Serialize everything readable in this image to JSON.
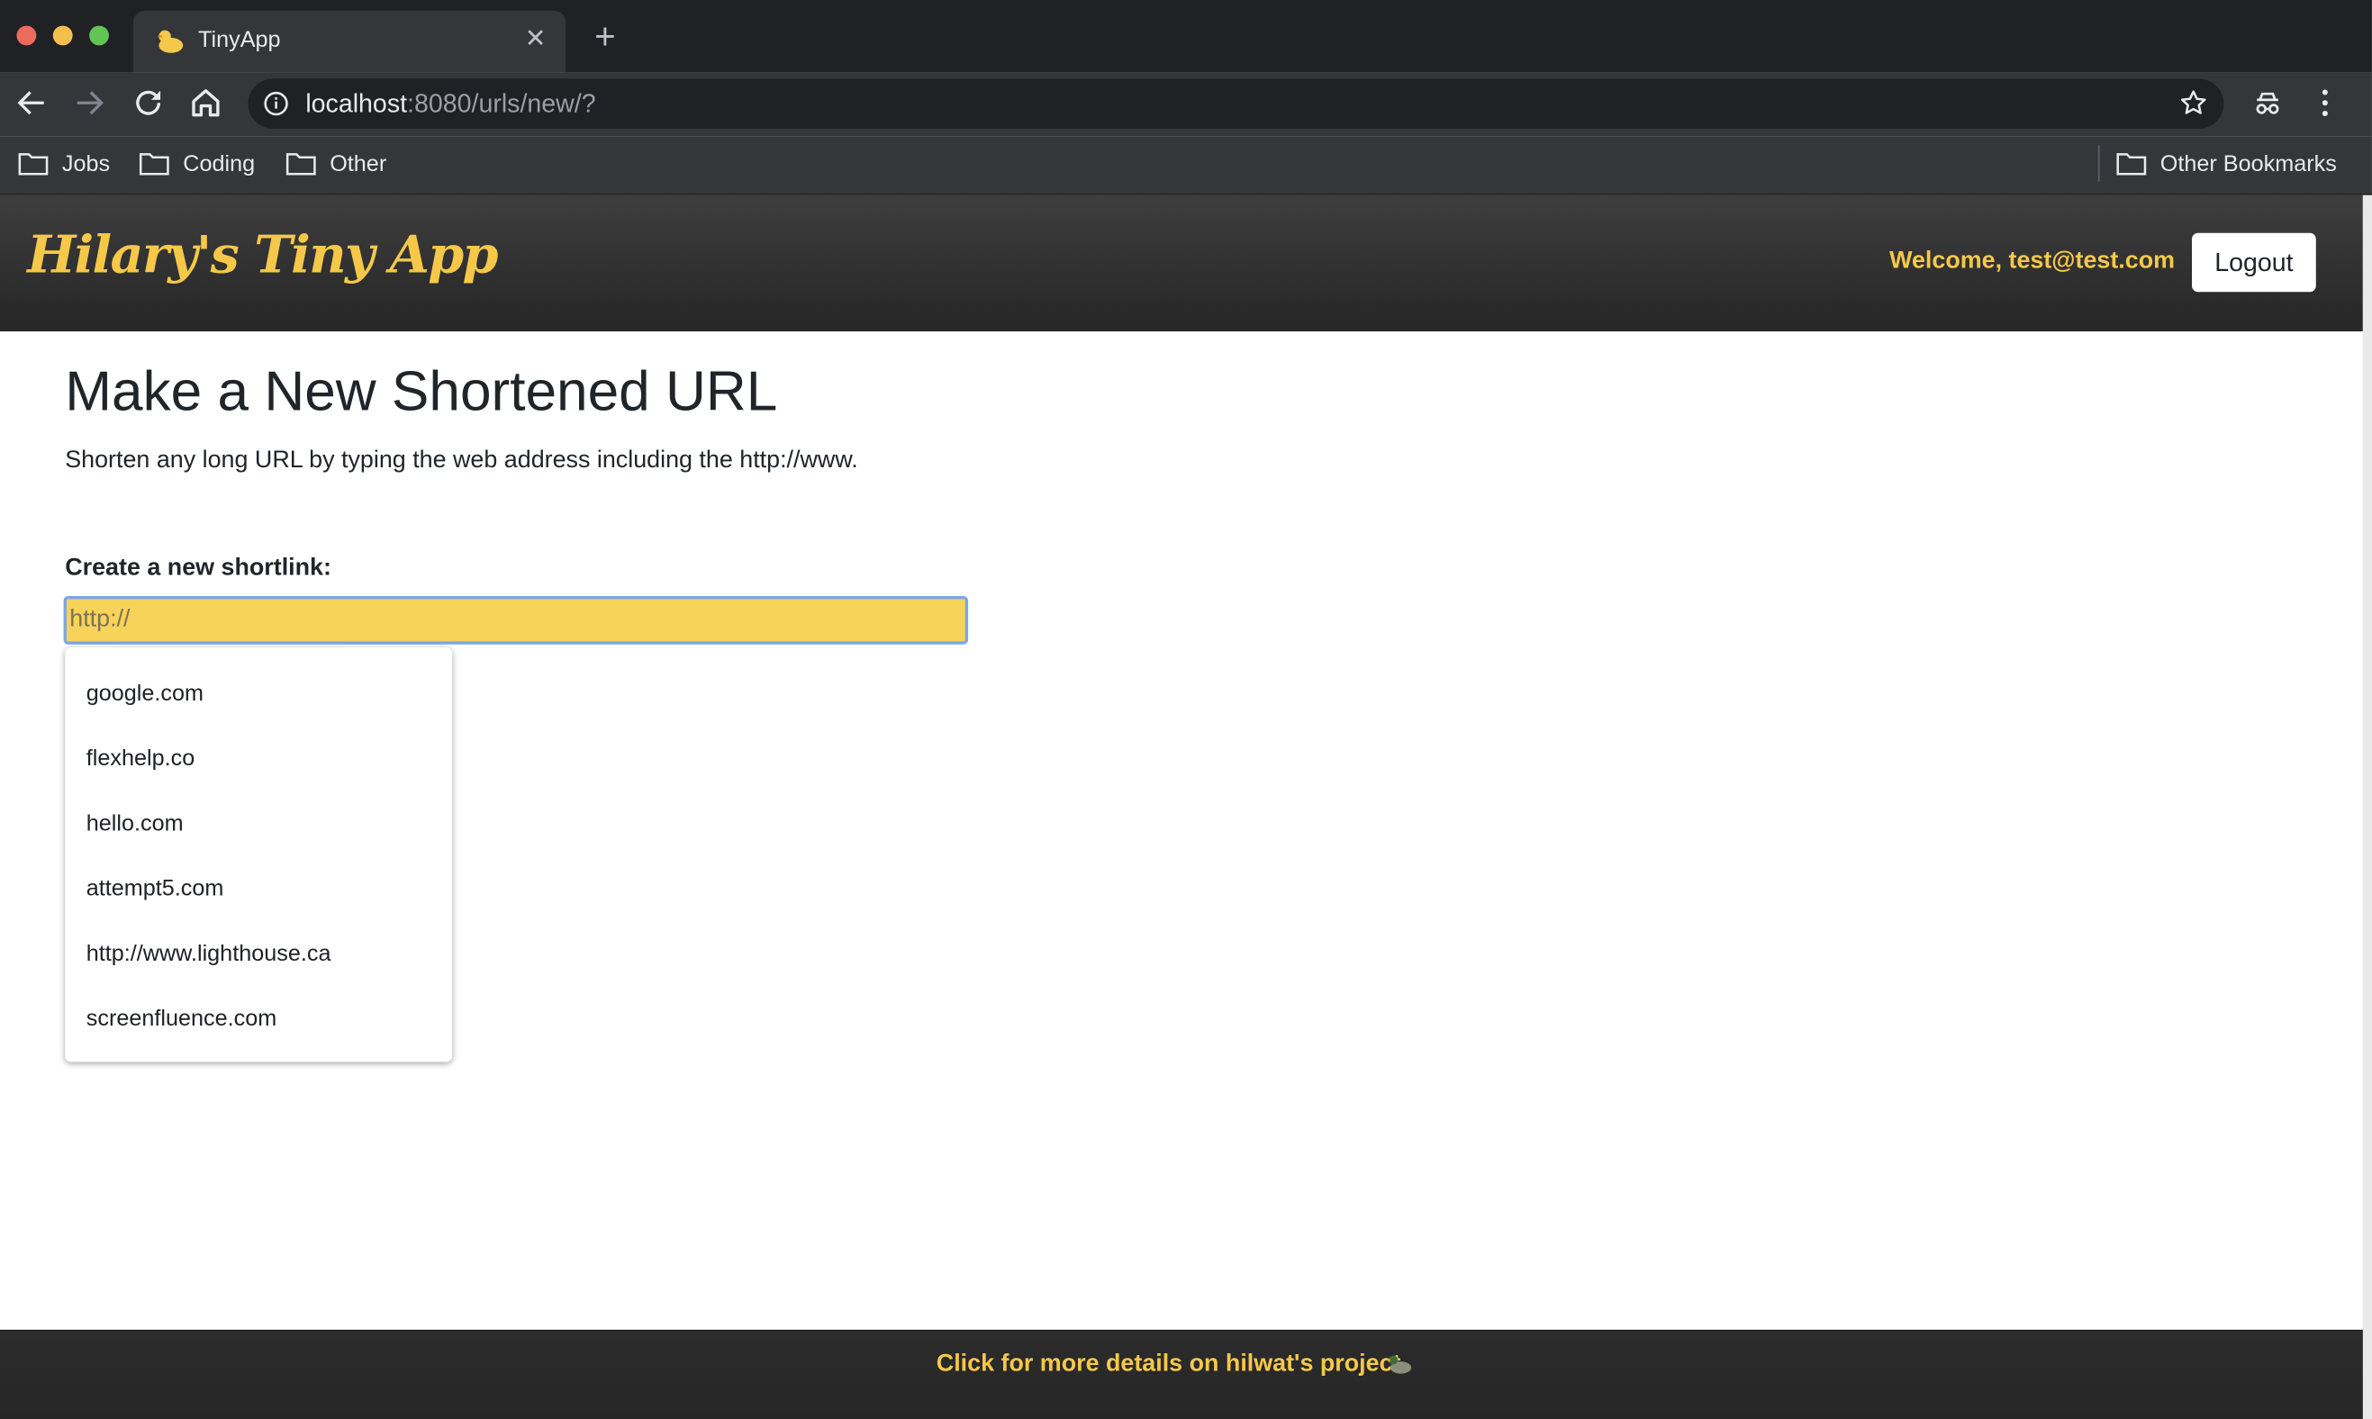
{
  "browser": {
    "tab_title": "TinyApp",
    "tab_icon": "duck-icon",
    "url_host": "localhost",
    "url_rest": ":8080/urls/new/?",
    "bookmarks": [
      {
        "label": "Jobs",
        "icon": "folder-icon"
      },
      {
        "label": "Coding",
        "icon": "folder-icon"
      },
      {
        "label": "Other",
        "icon": "folder-icon"
      }
    ],
    "other_bookmarks": "Other Bookmarks"
  },
  "header": {
    "brand": "Hilary's Tiny App",
    "welcome": "Welcome, test@test.com",
    "logout_label": "Logout"
  },
  "main": {
    "title": "Make a New Shortened URL",
    "subtitle": "Shorten any long URL by typing the web address including the http://www.",
    "field_label": "Create a new shortlink:",
    "input_placeholder": "http://",
    "input_value": "",
    "suggestions": [
      "google.com",
      "flexhelp.co",
      "hello.com",
      "attempt5.com",
      "http://www.lighthouse.ca",
      "screenfluence.com"
    ]
  },
  "footer": {
    "link_text": "Click for more details on hilwat's project"
  },
  "colors": {
    "accent_yellow": "#f5c84a",
    "input_bg": "#f8d35a",
    "header_dark": "#2b2b2b"
  }
}
